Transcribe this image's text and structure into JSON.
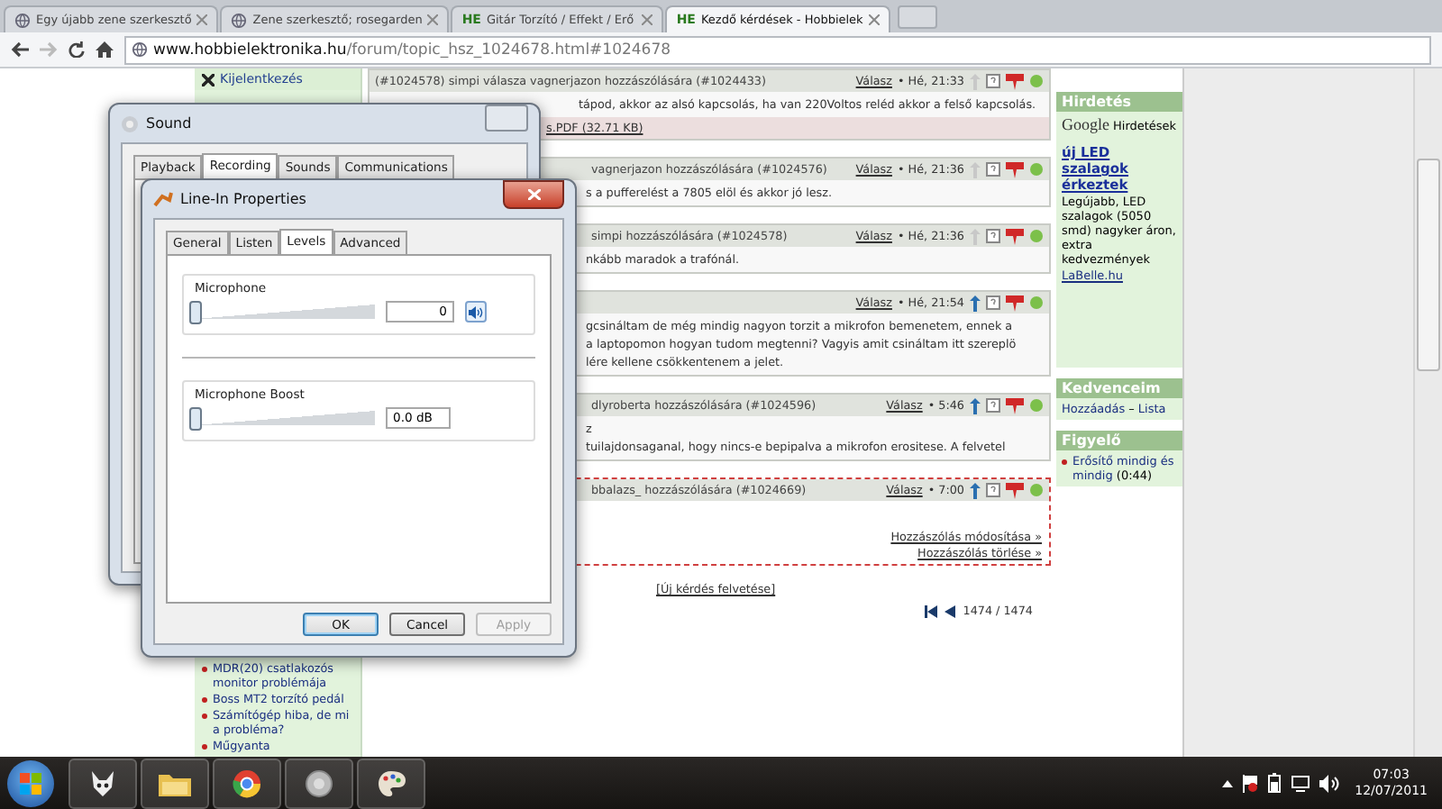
{
  "browser": {
    "tabs": [
      {
        "title": "Egy újabb zene szerkesztő",
        "selected": false
      },
      {
        "title": "Zene szerkesztő; rosegarden",
        "selected": false
      },
      {
        "title": "Gitár Torzító / Effekt / Erő",
        "favicon_text": "HE",
        "selected": false
      },
      {
        "title": "Kezdő kérdések - Hobbielek",
        "favicon_text": "HE",
        "selected": true
      }
    ],
    "url_host": "www.hobbielektronika.hu",
    "url_path": "/forum/topic_hsz_1024678.html#1024678"
  },
  "left_sidebar": {
    "top_link": "Kijelentkezés",
    "topics": [
      "MDR(20) csatlakozós monitor problémája",
      "Boss MT2 torzító pedál",
      "Számítógép hiba, de mi a probléma?",
      "Műgyanta"
    ]
  },
  "posts": [
    {
      "header": "(#1024578) simpi válasza vagnerjazon hozzászólására (#1024433)",
      "reply": "Válasz",
      "time": "• Hé, 21:33",
      "arrow_active": false,
      "own": false,
      "body": [
        "tápod, akkor az alsó kapcsolás, ha van 220Voltos reléd akkor a felső kapcsolás."
      ],
      "attachment": "s.PDF (32.71 KB)"
    },
    {
      "header": "vagnerjazon hozzászólására (#1024576)",
      "reply": "Válasz",
      "time": "• Hé, 21:36",
      "arrow_active": false,
      "own": false,
      "body": [
        "s a pufferelést a 7805 elöl és akkor jó lesz."
      ]
    },
    {
      "header": "simpi hozzászólására (#1024578)",
      "reply": "Válasz",
      "time": "• Hé, 21:36",
      "arrow_active": false,
      "own": false,
      "body": [
        "nkább maradok a trafónál."
      ]
    },
    {
      "reply": "Válasz",
      "time": "• Hé, 21:54",
      "arrow_active": true,
      "own": false,
      "body": [
        "gcsináltam de még mindig nagyon torzit a mikrofon bemenetem, ennek a",
        "a laptopomon hogyan tudom megtenni? Vagyis amit csináltam itt szereplö",
        "lére kellene csökkentenem a jelet."
      ]
    },
    {
      "header": "dlyroberta hozzászólására (#1024596)",
      "reply": "Válasz",
      "time": "• 5:46",
      "arrow_active": true,
      "own": false,
      "body": [
        "z",
        "tuilajdonsaganal, hogy nincs-e bepipalva a mikrofon erositese. A felvetel"
      ]
    },
    {
      "header": "bbalazs_ hozzászólására (#1024669)",
      "reply": "Válasz",
      "time": "• 7:00",
      "arrow_active": true,
      "own": true,
      "actions": [
        "Hozzászólás módosítása »",
        "Hozzászólás törlése »"
      ]
    }
  ],
  "new_question": "[Új kérdés felvetése]",
  "pagination": "1474 / 1474",
  "right_sidebar": {
    "ads": {
      "title": "Hirdetés",
      "provider": "Google",
      "provider_label": "Hirdetések",
      "ad_title": "új LED szalagok érkeztek",
      "ad_text": "Legújabb, LED szalagok (5050 smd) nagyker áron, extra kedvezmények",
      "ad_link": "LaBelle.hu"
    },
    "favorites": {
      "title": "Kedvenceim",
      "links": [
        "Hozzáadás",
        "Lista"
      ],
      "separator": "–"
    },
    "watch": {
      "title": "Figyelő",
      "item": "Erősítő mindig és mindig",
      "count": "(0:44)"
    }
  },
  "sound_window": {
    "title": "Sound",
    "tabs": [
      {
        "label": "Playback",
        "selected": false
      },
      {
        "label": "Recording",
        "selected": true
      },
      {
        "label": "Sounds",
        "selected": false
      },
      {
        "label": "Communications",
        "selected": false
      }
    ]
  },
  "properties_window": {
    "title": "Line-In Properties",
    "tabs": [
      {
        "label": "General",
        "selected": false
      },
      {
        "label": "Listen",
        "selected": false
      },
      {
        "label": "Levels",
        "selected": true
      },
      {
        "label": "Advanced",
        "selected": false
      }
    ],
    "groups": [
      {
        "label": "Microphone",
        "level": 0,
        "value": "0",
        "has_mute": true
      },
      {
        "label": "Microphone Boost",
        "level": 0,
        "value": "0.0 dB",
        "has_mute": false
      }
    ],
    "buttons": [
      {
        "label": "OK",
        "disabled": false,
        "default": true
      },
      {
        "label": "Cancel",
        "disabled": false,
        "default": false
      },
      {
        "label": "Apply",
        "disabled": true,
        "default": false
      }
    ]
  },
  "taskbar": {
    "clock_time": "07:03",
    "clock_date": "12/07/2011"
  }
}
